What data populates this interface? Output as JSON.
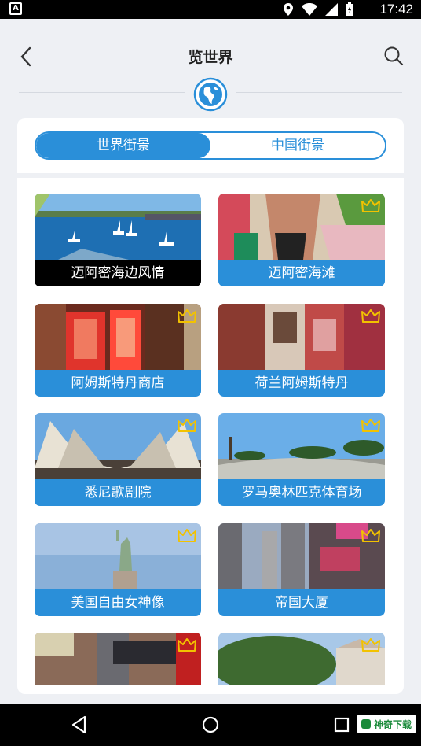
{
  "status_bar": {
    "time": "17:42",
    "icons": [
      "notification-a-icon",
      "location-icon",
      "wifi-icon",
      "signal-icon",
      "battery-icon"
    ]
  },
  "header": {
    "title": "览世界",
    "back_icon": "chevron-left-icon",
    "search_icon": "search-icon",
    "globe_icon": "globe-icon"
  },
  "tabs": [
    {
      "label": "世界街景",
      "active": true
    },
    {
      "label": "中国街景",
      "active": false
    }
  ],
  "places": [
    {
      "label": "迈阿密海边风情",
      "premium": false
    },
    {
      "label": "迈阿密海滩",
      "premium": true
    },
    {
      "label": "阿姆斯特丹商店",
      "premium": true
    },
    {
      "label": "荷兰阿姆斯特丹",
      "premium": true
    },
    {
      "label": "悉尼歌剧院",
      "premium": true
    },
    {
      "label": "罗马奥林匹克体育场",
      "premium": true
    },
    {
      "label": "美国自由女神像",
      "premium": true
    },
    {
      "label": "帝国大厦",
      "premium": true
    },
    {
      "label": "",
      "premium": true
    },
    {
      "label": "",
      "premium": true
    }
  ],
  "nav_bar": {
    "back": "triangle-back-icon",
    "home": "circle-home-icon",
    "recents": "square-recents-icon",
    "watermark": "神奇下载"
  },
  "colors": {
    "accent": "#2a8fd9",
    "background": "#eef0f4",
    "crown": "#f2c200"
  }
}
